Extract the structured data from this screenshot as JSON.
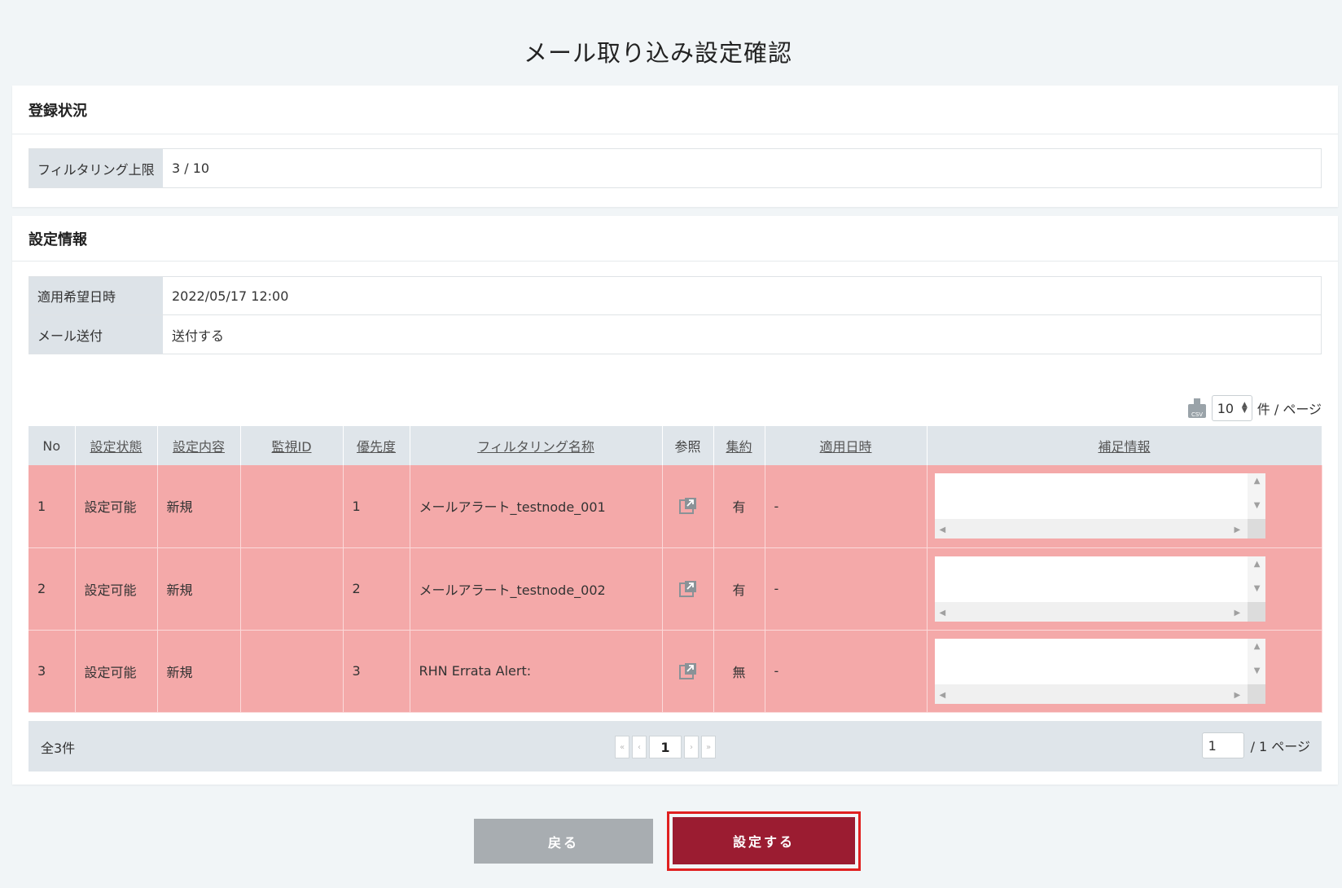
{
  "page_title": "メール取り込み設定確認",
  "registration": {
    "heading": "登録状況",
    "rows": [
      {
        "label": "フィルタリング上限",
        "value": "3 / 10"
      }
    ]
  },
  "settings": {
    "heading": "設定情報",
    "rows": [
      {
        "label": "適用希望日時",
        "value": "2022/05/17 12:00"
      },
      {
        "label": "メール送付",
        "value": "送付する"
      }
    ]
  },
  "toolbar": {
    "csv_icon": "csv-download-icon",
    "per_page_value": "10",
    "per_page_suffix": "件 / ページ"
  },
  "table": {
    "columns": [
      "No",
      "設定状態",
      "設定内容",
      "監視ID",
      "優先度",
      "フィルタリング名称",
      "参照",
      "集約",
      "適用日時",
      "補足情報"
    ],
    "rows": [
      {
        "no": "1",
        "status": "設定可能",
        "content": "新規",
        "monitor_id": "",
        "priority": "1",
        "name": "メールアラート_testnode_001",
        "aggregate": "有",
        "apply_date": "-",
        "note": ""
      },
      {
        "no": "2",
        "status": "設定可能",
        "content": "新規",
        "monitor_id": "",
        "priority": "2",
        "name": "メールアラート_testnode_002",
        "aggregate": "有",
        "apply_date": "-",
        "note": ""
      },
      {
        "no": "3",
        "status": "設定可能",
        "content": "新規",
        "monitor_id": "",
        "priority": "3",
        "name": "RHN Errata Alert:",
        "aggregate": "無",
        "apply_date": "-",
        "note": ""
      }
    ],
    "row_color": "#f4a9a9"
  },
  "pager": {
    "total": "全3件",
    "current_page": "1",
    "page_input": "1",
    "page_suffix": "/  1 ページ"
  },
  "buttons": {
    "back": "戻る",
    "submit": "設定する"
  },
  "colors": {
    "submit_bg": "#9b1c31",
    "back_bg": "#a8adb1",
    "highlight_border": "#e02020"
  }
}
